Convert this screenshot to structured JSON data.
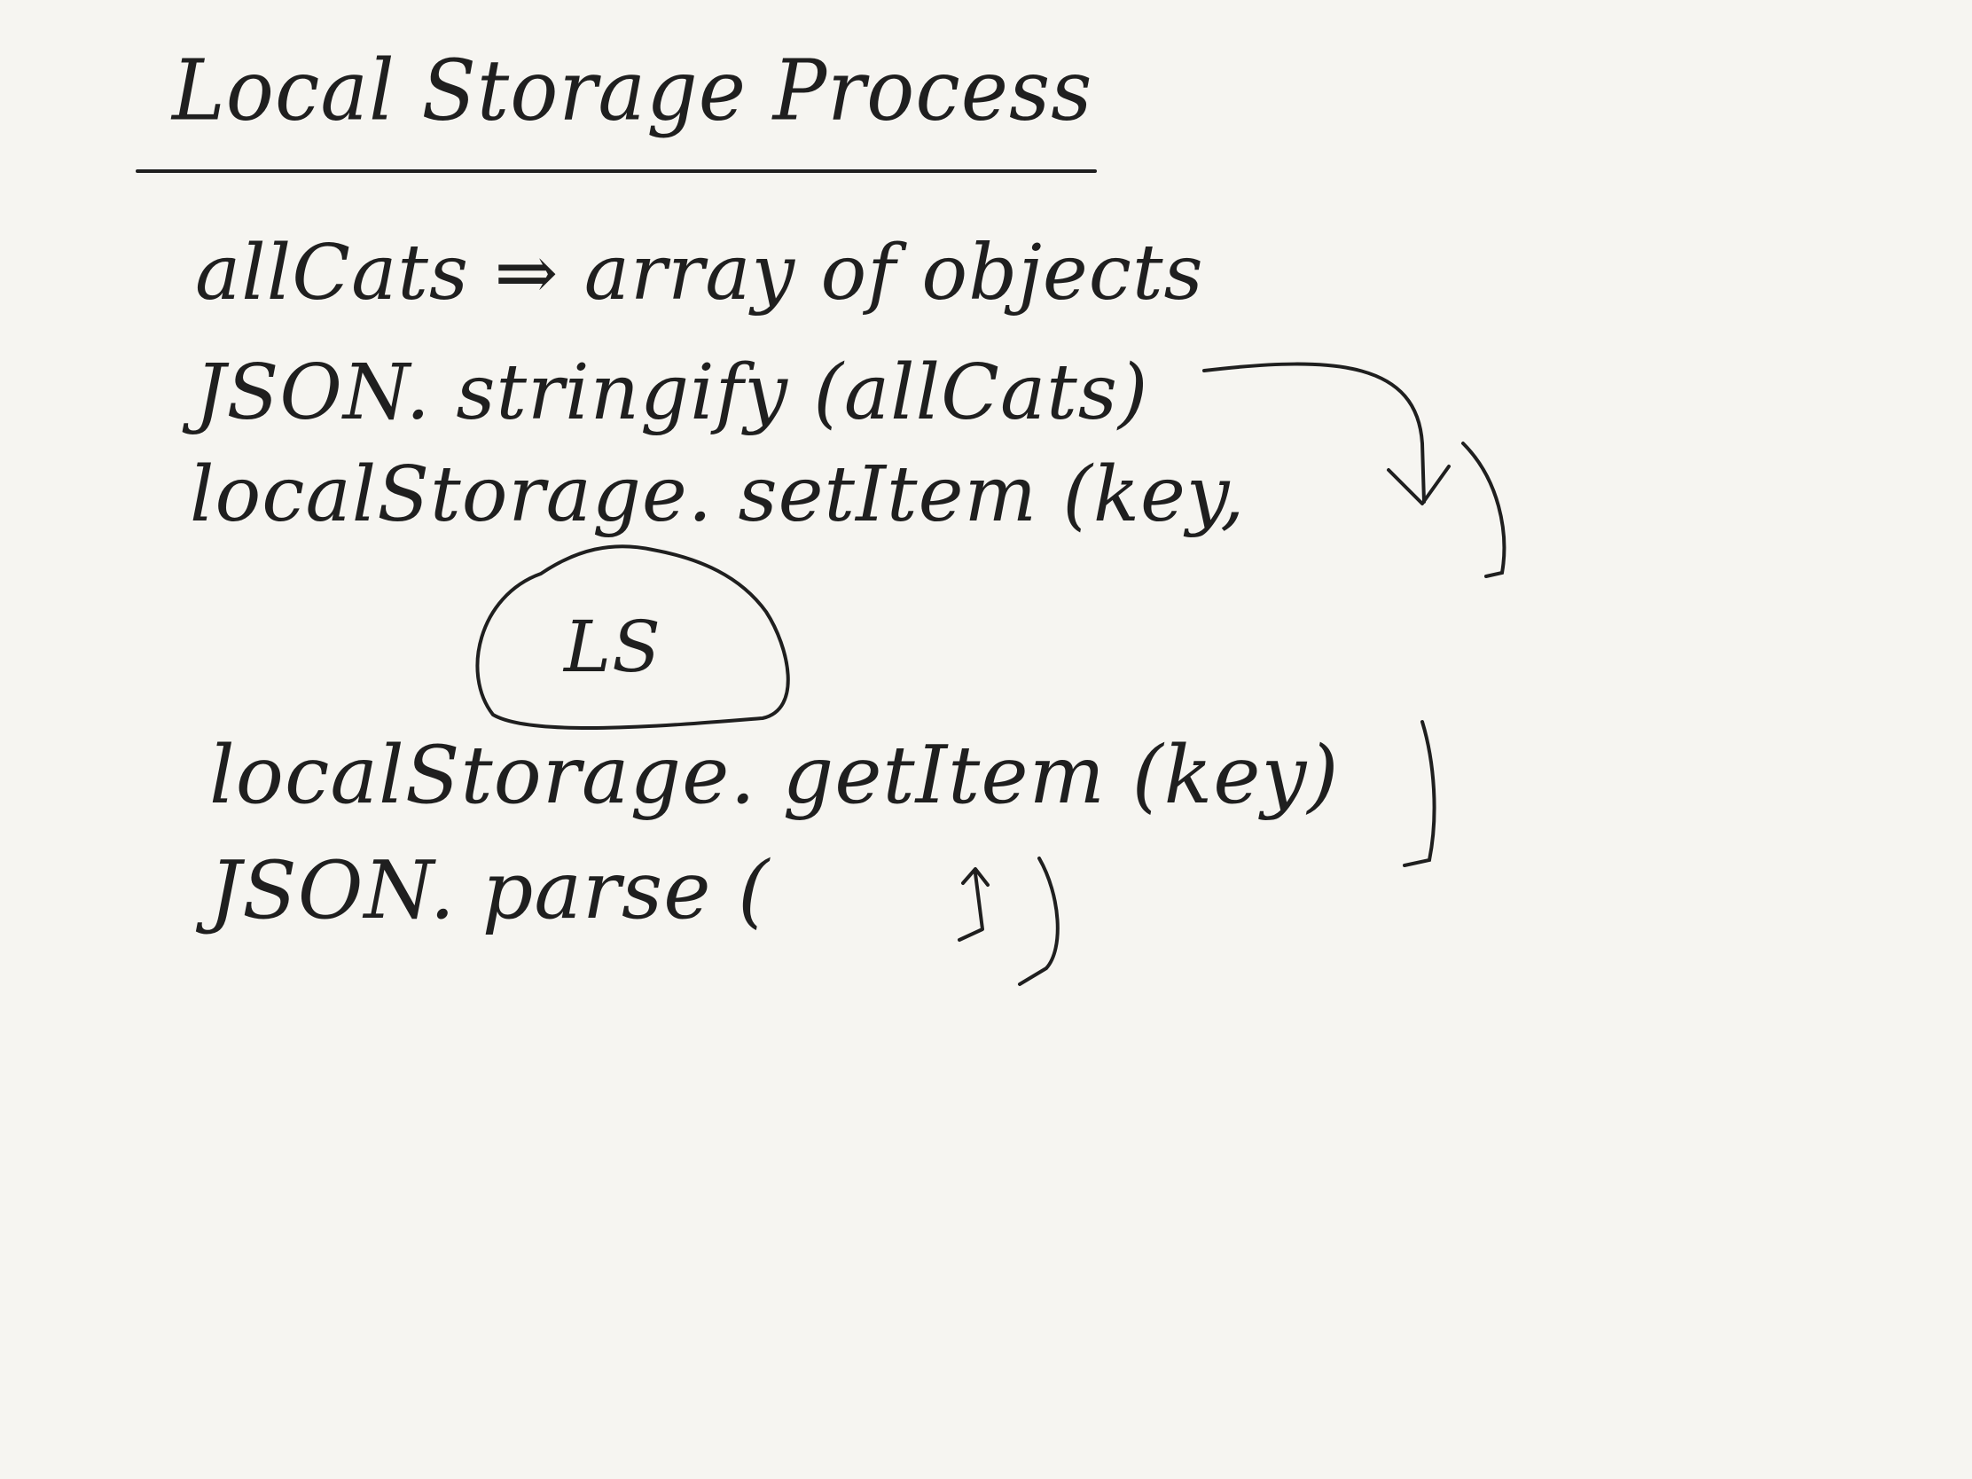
{
  "note": {
    "title": "Local Storage Process",
    "lines": [
      "allCats ⇒ array of objects",
      "JSON. stringify (allCats)",
      "localStorage. setItem (key,",
      "localStorage. getItem (key)",
      "JSON. parse ("
    ],
    "bubble_label": "LS"
  },
  "colors": {
    "background": "#f6f5f1",
    "ink": "#1f1f1f"
  }
}
